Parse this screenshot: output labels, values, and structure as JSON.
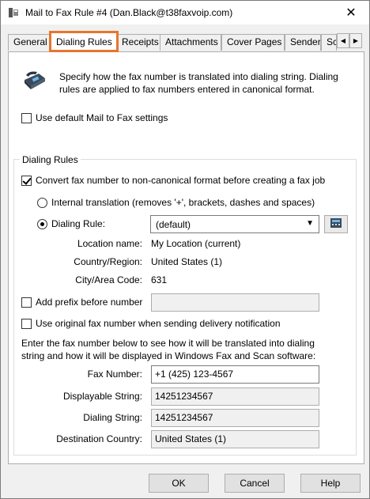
{
  "window": {
    "title": "Mail to Fax Rule #4 (Dan.Black@t38faxvoip.com)",
    "close": "✕"
  },
  "tabs": [
    {
      "label": "General"
    },
    {
      "label": "Dialing Rules"
    },
    {
      "label": "Receipts"
    },
    {
      "label": "Attachments"
    },
    {
      "label": "Cover Pages"
    },
    {
      "label": "Sender"
    },
    {
      "label": "Sc"
    }
  ],
  "tab_scroll": {
    "left": "◀",
    "right": "▶"
  },
  "description": "Specify how the fax number is translated into dialing string. Dialing rules are applied to fax numbers entered in canonical format.",
  "use_default": {
    "label": "Use default Mail to Fax settings",
    "checked": false
  },
  "group": {
    "title": "Dialing Rules",
    "convert": {
      "label": "Convert fax number to non-canonical format before creating a fax job",
      "checked": true
    },
    "internal": {
      "label": "Internal translation (removes '+', brackets, dashes and spaces)",
      "selected": false
    },
    "dialing_rule": {
      "label": "Dialing Rule:",
      "selected": true,
      "value": "(default)"
    },
    "location": {
      "label": "Location name:",
      "value": "My Location (current)"
    },
    "country": {
      "label": "Country/Region:",
      "value": "United States (1)"
    },
    "area": {
      "label": "City/Area Code:",
      "value": "631"
    },
    "prefix": {
      "label": "Add prefix before number",
      "checked": false,
      "value": ""
    },
    "original": {
      "label": "Use original fax number when sending delivery notification",
      "checked": false
    },
    "enter_text": "Enter the fax number below to see how it will be translated into dialing string and how it will be displayed in Windows Fax and Scan software:",
    "fax_number": {
      "label": "Fax Number:",
      "value": "+1 (425) 123-4567"
    },
    "displayable": {
      "label": "Displayable String:",
      "value": "14251234567"
    },
    "dialing_string": {
      "label": "Dialing String:",
      "value": "14251234567"
    },
    "destination": {
      "label": "Destination Country:",
      "value": "United States (1)"
    }
  },
  "buttons": {
    "ok": "OK",
    "cancel": "Cancel",
    "help": "Help"
  },
  "colors": {
    "active_tab_highlight": "#e8752b"
  }
}
